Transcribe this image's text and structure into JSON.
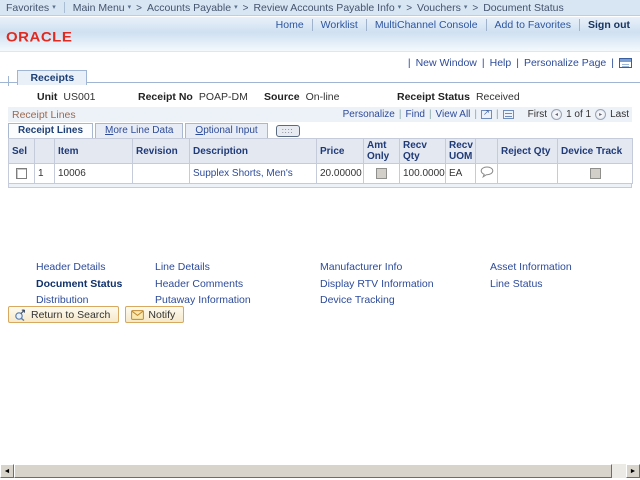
{
  "colors": {
    "brand_red": "#e0291f",
    "link_blue": "#2d4b9a",
    "grid_title_brown": "#9a6a50",
    "bar_blue": "#d8e5f2"
  },
  "icons": {
    "breadcrumb_arrow": "▾",
    "prev_arrow": "◂",
    "next_arrow": "▸",
    "scroll_left": "◄",
    "scroll_right": "►",
    "show_columns": "::::"
  },
  "breadcrumb": {
    "favorites": "Favorites",
    "items": [
      "Main Menu",
      "Accounts Payable",
      "Review Accounts Payable Info",
      "Vouchers",
      "Document Status"
    ]
  },
  "header": {
    "logo": "ORACLE",
    "nav": [
      "Home",
      "Worklist",
      "MultiChannel Console",
      "Add to Favorites"
    ],
    "signout": "Sign out"
  },
  "page_utils": {
    "new_window": "New Window",
    "help": "Help",
    "personalize_page": "Personalize Page"
  },
  "page_tab": "Receipts",
  "summary": {
    "unit_label": "Unit",
    "unit": "US001",
    "receipt_no_label": "Receipt No",
    "receipt_no": "POAP-DM",
    "source_label": "Source",
    "source": "On-line",
    "status_label": "Receipt Status",
    "status": "Received"
  },
  "grid": {
    "title": "Receipt Lines",
    "toolbar": {
      "personalize": "Personalize",
      "find": "Find",
      "view_all": "View All",
      "first": "First",
      "page": "1 of 1",
      "last": "Last"
    },
    "tabs": [
      "Receipt Lines",
      "More Line Data",
      "Optional Input"
    ],
    "columns": [
      "Sel",
      "",
      "Item",
      "Revision",
      "Description",
      "Price",
      "Amt Only",
      "Recv Qty",
      "Recv UOM",
      "",
      "Reject Qty",
      "Device Track"
    ],
    "rows": [
      {
        "num": "1",
        "item": "10006",
        "revision": "",
        "description": "Supplex Shorts, Men's",
        "price": "20.00000",
        "recv_qty": "100.0000",
        "recv_uom": "EA",
        "reject_qty": ""
      }
    ]
  },
  "links": {
    "rows": [
      [
        "Header Details",
        "Line Details",
        "Manufacturer Info",
        "Asset Information"
      ],
      [
        "Document Status",
        "Header Comments",
        "Display RTV Information",
        "Line Status"
      ],
      [
        "Distribution",
        "Putaway Information",
        "Device Tracking",
        ""
      ]
    ]
  },
  "buttons": {
    "return_to_search": "Return to Search",
    "notify": "Notify"
  }
}
